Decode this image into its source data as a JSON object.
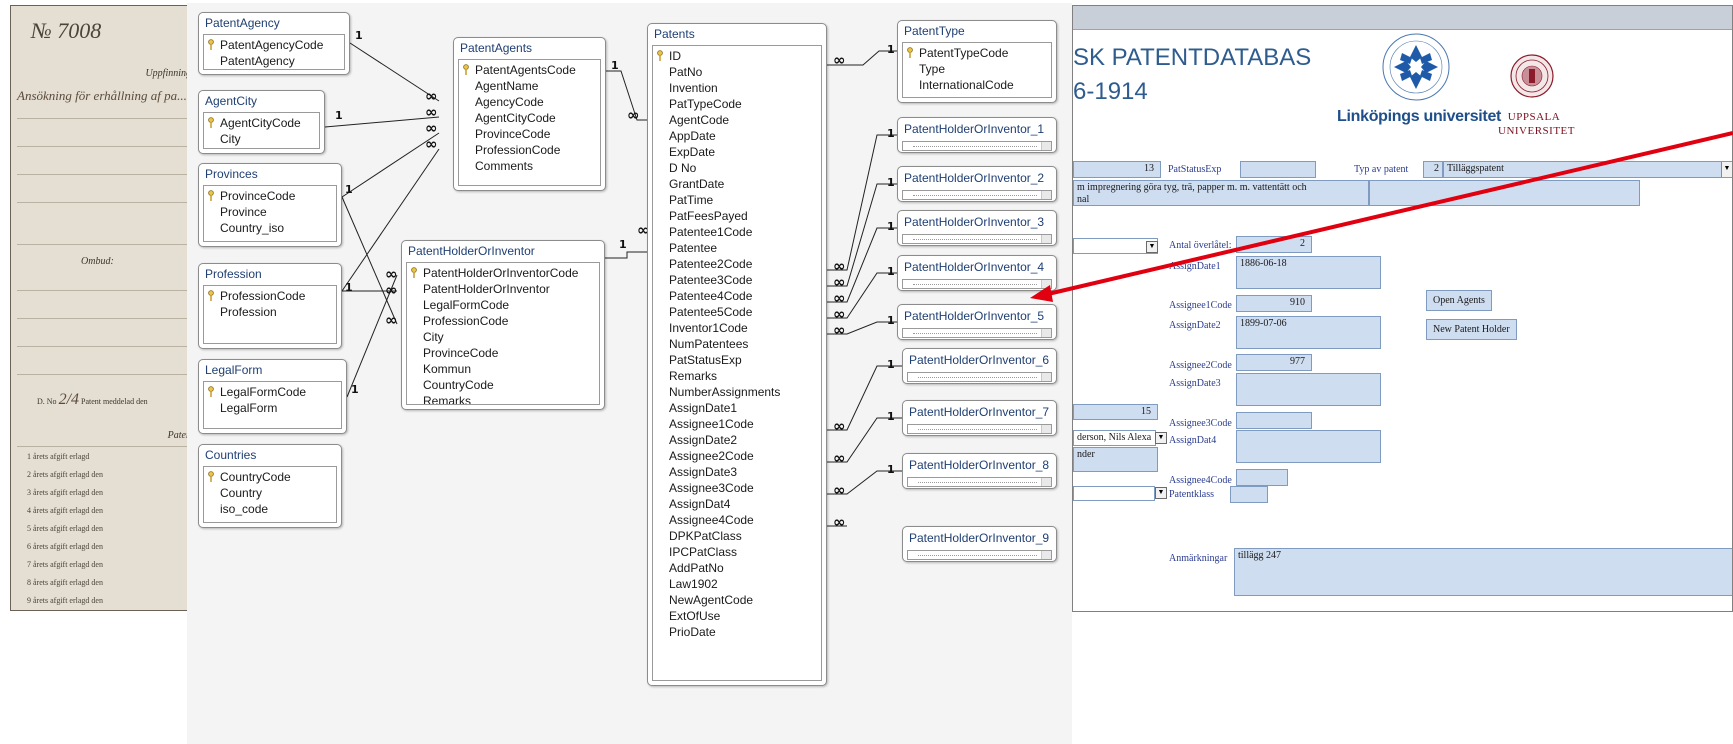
{
  "ledger": {
    "number": "№ 7008",
    "header": "Uppfinning",
    "handwriting": "Ansökning för erhållning af pa...",
    "ombud": "Ombud:",
    "dno_prefix": "D. No",
    "dno_value": "2/4",
    "dno_suffix": "Patent meddelad den",
    "patent_label": "Paten",
    "fees": [
      "1 årets afgift erlagd",
      "2 årets afgift erlagd den",
      "3 årets afgift erlagd den",
      "4 årets afgift erlagd den",
      "5 årets afgift erlagd den",
      "6 årets afgift erlagd den",
      "7 årets afgift erlagd den",
      "8 årets afgift erlagd den",
      "9 årets afgift erlagd den"
    ]
  },
  "diagram": {
    "tables": {
      "patent_agency": {
        "title": "PatentAgency",
        "fields": [
          "PatentAgencyCode",
          "PatentAgency"
        ]
      },
      "agent_city": {
        "title": "AgentCity",
        "fields": [
          "AgentCityCode",
          "City"
        ]
      },
      "provinces": {
        "title": "Provinces",
        "fields": [
          "ProvinceCode",
          "Province",
          "Country_iso"
        ]
      },
      "profession": {
        "title": "Profession",
        "fields": [
          "ProfessionCode",
          "Profession"
        ]
      },
      "legal_form": {
        "title": "LegalForm",
        "fields": [
          "LegalFormCode",
          "LegalForm"
        ]
      },
      "countries": {
        "title": "Countries",
        "fields": [
          "CountryCode",
          "Country",
          "iso_code"
        ]
      },
      "patent_agents": {
        "title": "PatentAgents",
        "fields": [
          "PatentAgentsCode",
          "AgentName",
          "AgencyCode",
          "AgentCityCode",
          "ProvinceCode",
          "ProfessionCode",
          "Comments"
        ]
      },
      "holder": {
        "title": "PatentHolderOrInventor",
        "fields": [
          "PatentHolderOrInventorCode",
          "PatentHolderOrInventor",
          "LegalFormCode",
          "ProfessionCode",
          "City",
          "ProvinceCode",
          "Kommun",
          "CountryCode",
          "Remarks"
        ]
      },
      "patents": {
        "title": "Patents",
        "fields": [
          "ID",
          "PatNo",
          "Invention",
          "PatTypeCode",
          "AgentCode",
          "AppDate",
          "ExpDate",
          "D No",
          "GrantDate",
          "PatTime",
          "PatFeesPayed",
          "Patentee1Code",
          "Patentee",
          "Patentee2Code",
          "Patentee3Code",
          "Patentee4Code",
          "Patentee5Code",
          "Inventor1Code",
          "NumPatentees",
          "PatStatusExp",
          "Remarks",
          "NumberAssignments",
          "AssignDate1",
          "Assignee1Code",
          "AssignDate2",
          "Assignee2Code",
          "AssignDate3",
          "Assignee3Code",
          "AssignDat4",
          "Assignee4Code",
          "DPKPatClass",
          "IPCPatClass",
          "AddPatNo",
          "Law1902",
          "NewAgentCode",
          "ExtOfUse",
          "PrioDate"
        ]
      },
      "patent_type": {
        "title": "PatentType",
        "fields": [
          "PatentTypeCode",
          "Type",
          "InternationalCode"
        ]
      }
    },
    "holder_aliases": [
      "PatentHolderOrInventor_1",
      "PatentHolderOrInventor_2",
      "PatentHolderOrInventor_3",
      "PatentHolderOrInventor_4",
      "PatentHolderOrInventor_5",
      "PatentHolderOrInventor_6",
      "PatentHolderOrInventor_7",
      "PatentHolderOrInventor_8",
      "PatentHolderOrInventor_9"
    ],
    "one_symbol": "1",
    "many_symbol": "∞"
  },
  "form": {
    "title_line1": "SK PATENTDATABAS",
    "title_line2": "6-1914",
    "liu_name": "Linköpings universitet",
    "uu_name_line1": "UPPSALA",
    "uu_name_line2": "UNIVERSITET",
    "labels": {
      "pat_status_exp": "PatStatusExp",
      "typ_av_patent": "Typ av patent",
      "antal_overlatelser": "Antal överlåtel:",
      "assign_date1": "AssignDate1",
      "assignee1_code": "Assignee1Code",
      "assign_date2": "AssignDate2",
      "assignee2_code": "Assignee2Code",
      "assign_date3": "AssignDate3",
      "assignee3_code": "Assignee3Code",
      "assign_dat4": "AssignDat4",
      "assignee4_code": "Assignee4Code",
      "patentklass": "Patentklass",
      "anmarkningar": "Anmärkningar"
    },
    "values": {
      "num_13": "13",
      "pat_type_code": "2",
      "pat_type_name": "Tilläggspatent",
      "invention_line1": "m impregnering göra tyg, trä, papper m. m. vattentätt och",
      "invention_line2": "nal",
      "antal": "2",
      "assign_date1": "1886-06-18",
      "assignee1_code": "910",
      "assign_date2": "1899-07-06",
      "assignee2_code": "977",
      "num_15": "15",
      "holder_name": "derson, Nils Alexa",
      "holder_sub": "nder",
      "anmarkningar": "tillägg 247"
    },
    "buttons": {
      "open_agents": "Open Agents",
      "new_patent_holder": "New Patent Holder"
    }
  },
  "colors": {
    "arrow": "#e0000f",
    "form_field": "#cfddf0",
    "form_label": "#2a3d8f",
    "diagram_title": "#1f3f73",
    "app_title": "#2e5c8e"
  }
}
